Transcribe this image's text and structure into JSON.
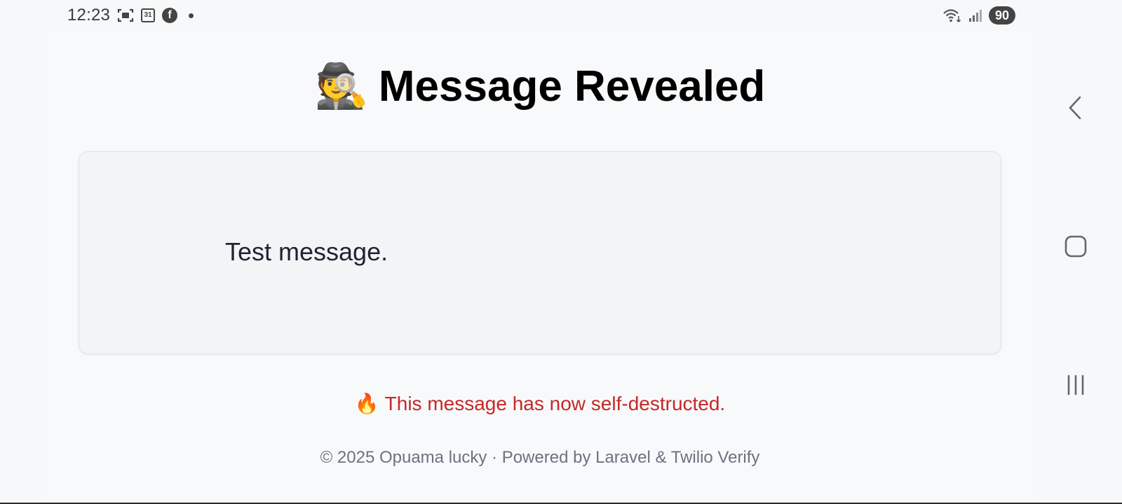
{
  "status_bar": {
    "time": "12:23",
    "calendar_day": "31",
    "facebook_glyph": "f",
    "battery": "90",
    "icons": [
      "screenshot-icon",
      "calendar-icon",
      "facebook-icon",
      "notification-dot-icon",
      "wifi-icon",
      "signal-icon",
      "battery-icon"
    ]
  },
  "page": {
    "title_emoji": "🕵️",
    "title": "Message Revealed",
    "message": "Test message.",
    "notice_emoji": "🔥",
    "notice": "This message has now self-destructed.",
    "footer": "© 2025 Opuama lucky · Powered by Laravel & Twilio Verify"
  },
  "colors": {
    "background": "#f8f9fb",
    "card": "#f3f4f6",
    "notice": "#c62828",
    "footer": "#6b7280"
  },
  "nav_bar": {
    "buttons": [
      "back-icon",
      "home-icon",
      "recents-icon"
    ]
  }
}
